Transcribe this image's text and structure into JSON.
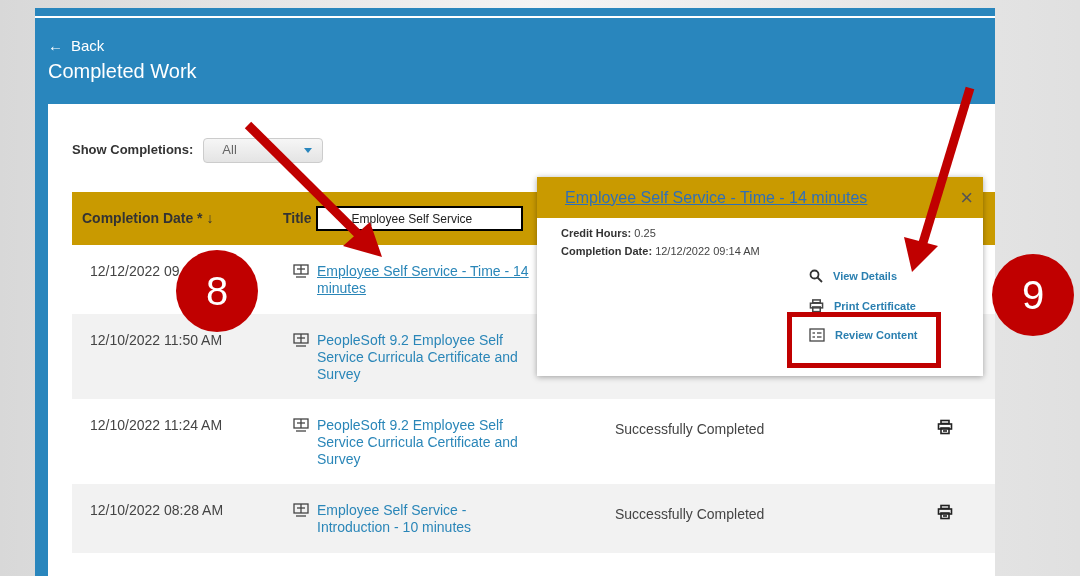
{
  "header": {
    "back_arrow": "←",
    "back": "Back",
    "title": "Completed Work"
  },
  "filter": {
    "label": "Show Completions:",
    "value": "All"
  },
  "table": {
    "columns": [
      {
        "label": "Completion Date *",
        "sort_arrow": "↓"
      },
      {
        "label": "Title",
        "filter_value": "Employee Self Service"
      }
    ],
    "rows": [
      {
        "date": "12/12/2022 09",
        "title": "Employee Self Service - Time - 14 minutes",
        "selected": true
      },
      {
        "date": "12/10/2022 11:50 AM",
        "title": "PeopleSoft 9.2 Employee Self Service Curricula Certificate and Survey",
        "selected": false
      },
      {
        "date": "12/10/2022 11:24 AM",
        "title": "PeopleSoft 9.2 Employee Self Service Curricula Certificate and Survey",
        "selected": false,
        "status": "Successfully Completed",
        "print_certificate": true
      },
      {
        "date": "12/10/2022 08:28 AM",
        "title": "Employee Self Service - Introduction - 10 minutes",
        "selected": false,
        "status": "Successfully Completed",
        "print_certificate": true
      }
    ]
  },
  "popover": {
    "title": "Employee Self Service - Time - 14 minutes",
    "close": "×",
    "fields": [
      {
        "label": "Credit Hours:",
        "value": "0.25"
      },
      {
        "label": "Completion Date:",
        "value": "12/12/2022 09:14 AM"
      }
    ],
    "actions": [
      {
        "kind": "details",
        "label": "View Details",
        "highlighted": false
      },
      {
        "kind": "print",
        "label": "Print Certificate",
        "highlighted": false
      },
      {
        "kind": "review",
        "label": "Review Content",
        "highlighted": true
      }
    ]
  },
  "callouts": [
    {
      "number": "8"
    },
    {
      "number": "9"
    }
  ]
}
